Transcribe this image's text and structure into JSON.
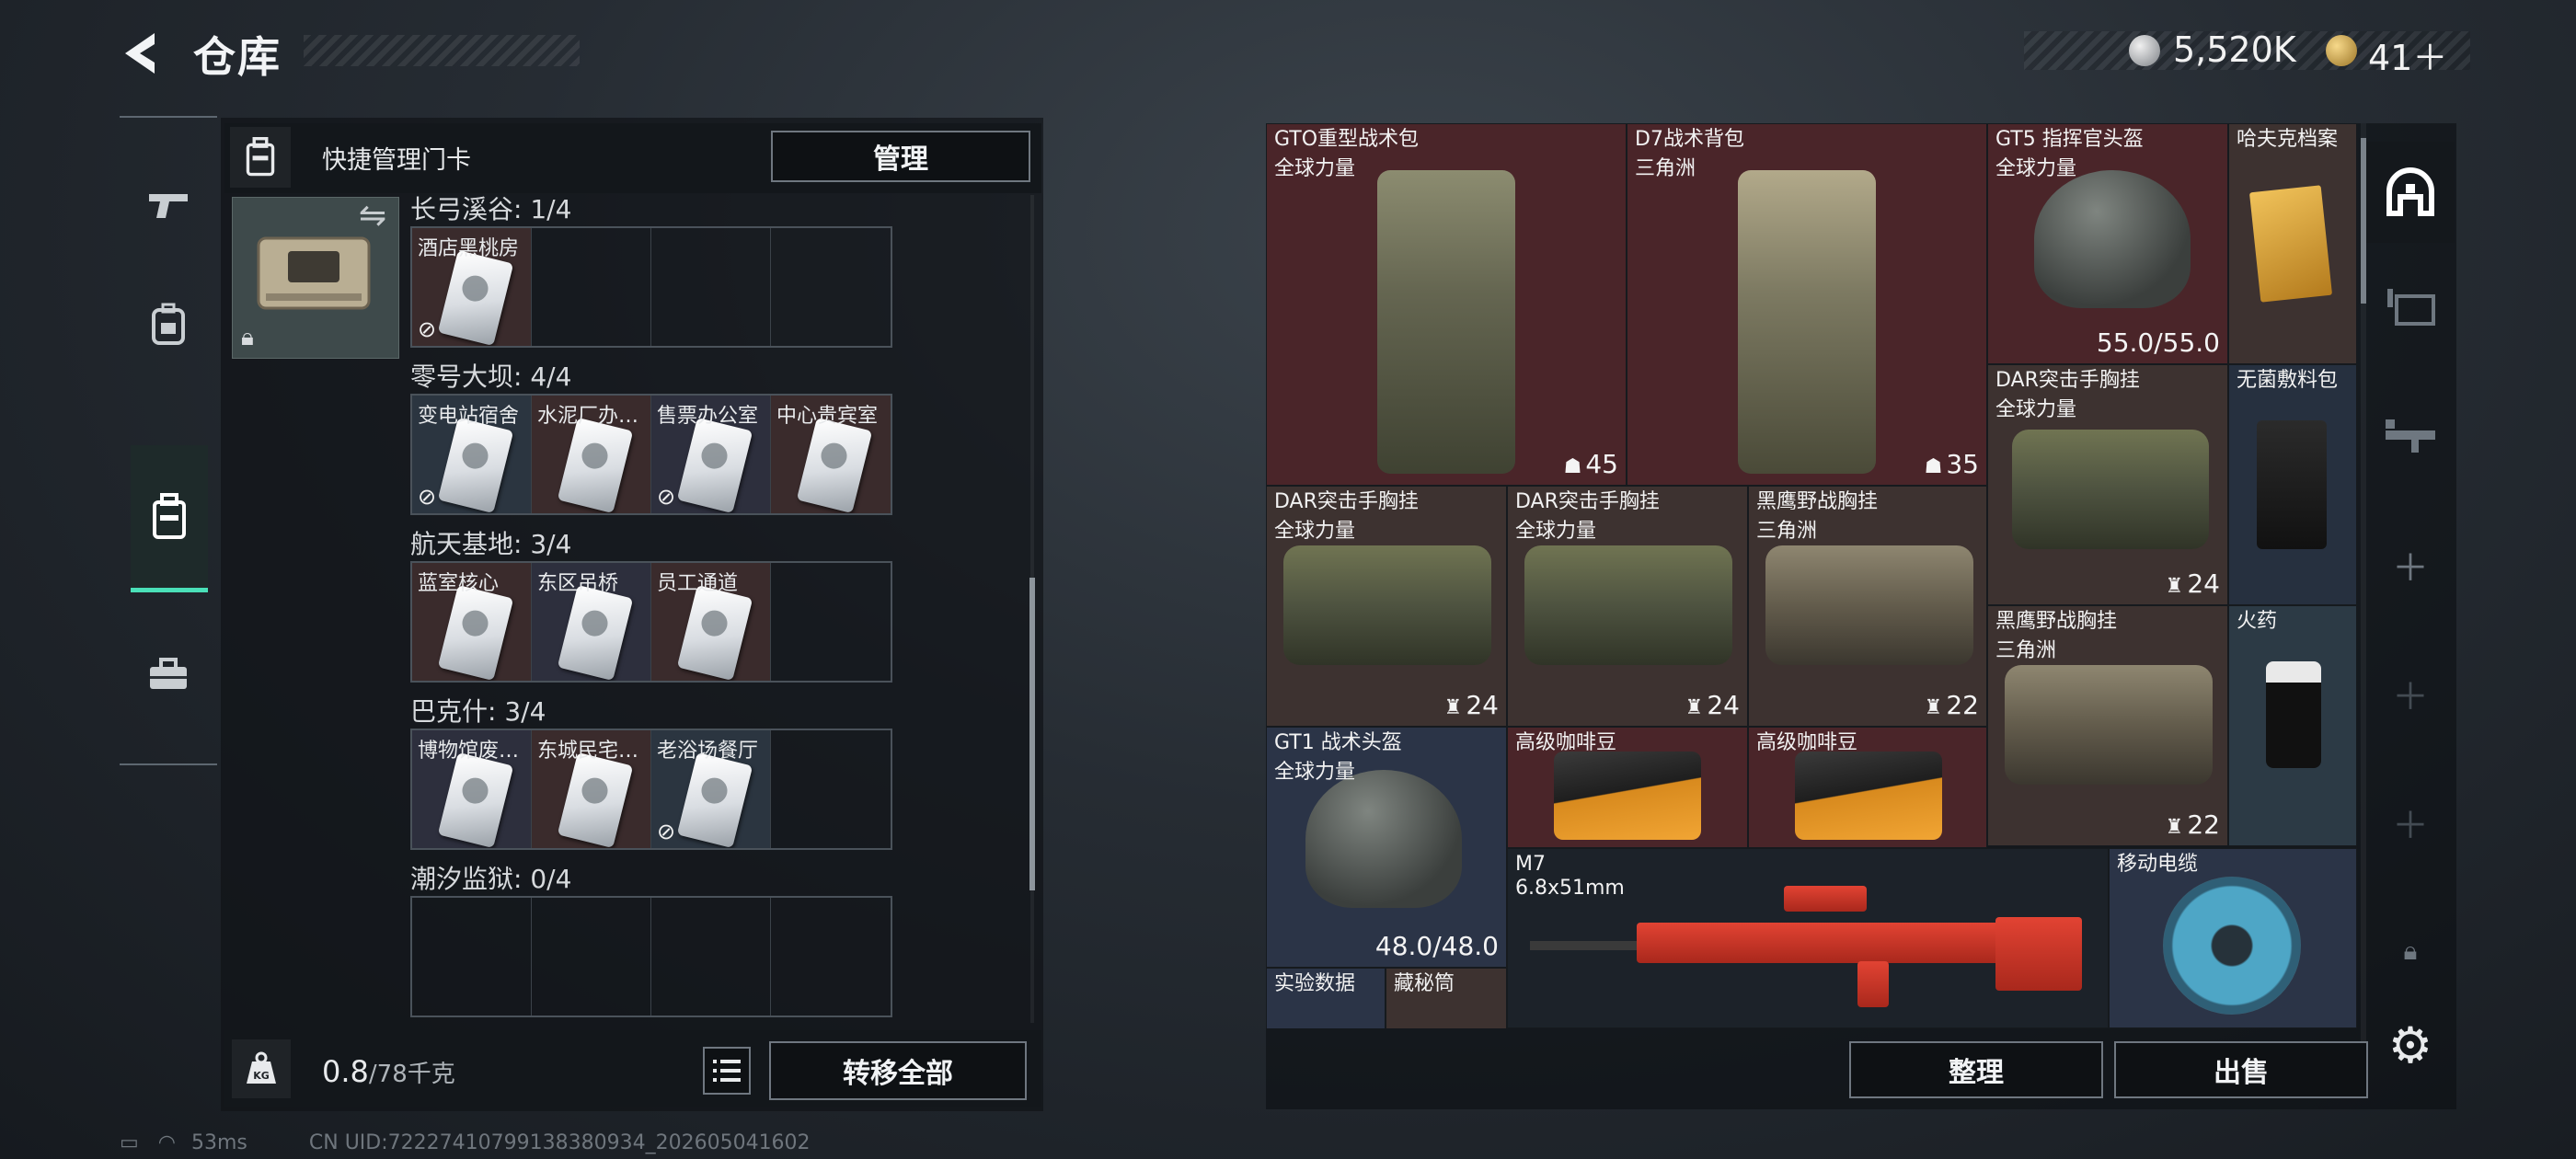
{
  "header": {
    "title": "仓库",
    "currency_silver": "5,520K",
    "currency_gold": "41＋"
  },
  "left_nav": {
    "items": [
      "weapons",
      "equipment",
      "keycards",
      "toolbox"
    ],
    "active": "keycards"
  },
  "keycard_panel": {
    "header_title": "快捷管理门卡",
    "manage_label": "管理",
    "zones": [
      {
        "label": "长弓溪谷: 1/4",
        "cards": [
          {
            "name": "酒店黑桃房",
            "has_card": true,
            "unavailable": true
          }
        ]
      },
      {
        "label": "零号大坝: 4/4",
        "cards": [
          {
            "name": "变电站宿舍",
            "has_card": true,
            "unavailable": true
          },
          {
            "name": "水泥厂办…",
            "has_card": true,
            "unavailable": false
          },
          {
            "name": "售票办公室",
            "has_card": true,
            "unavailable": true
          },
          {
            "name": "中心贵宾室",
            "has_card": true,
            "unavailable": false
          }
        ]
      },
      {
        "label": "航天基地: 3/4",
        "cards": [
          {
            "name": "蓝室核心",
            "has_card": true,
            "unavailable": false
          },
          {
            "name": "东区吊桥",
            "has_card": true,
            "unavailable": false
          },
          {
            "name": "员工通道",
            "has_card": true,
            "unavailable": false
          }
        ]
      },
      {
        "label": "巴克什: 3/4",
        "cards": [
          {
            "name": "博物馆废…",
            "has_card": true,
            "unavailable": false
          },
          {
            "name": "东城民宅…",
            "has_card": true,
            "unavailable": false
          },
          {
            "name": "老浴场餐厅",
            "has_card": true,
            "unavailable": true
          }
        ]
      },
      {
        "label": "潮汐监狱: 0/4",
        "cards": []
      }
    ],
    "weight": "0.8",
    "weight_capacity": "/78千克",
    "transfer_all_label": "转移全部"
  },
  "stash": {
    "items": [
      {
        "name": "GTO重型战术包",
        "sub": "全球力量",
        "stat": "45",
        "stat_icon": "capacity-icon"
      },
      {
        "name": "D7战术背包",
        "sub": "三角洲",
        "stat": "35",
        "stat_icon": "capacity-icon"
      },
      {
        "name": "GT5 指挥官头盔",
        "sub": "全球力量",
        "stat": "55.0/55.0"
      },
      {
        "name": "哈夫克档案",
        "sub": ""
      },
      {
        "name": "DAR突击手胸挂",
        "sub": "全球力量",
        "stat": "24",
        "stat_icon": "slots-icon"
      },
      {
        "name": "无菌敷料包",
        "sub": ""
      },
      {
        "name": "DAR突击手胸挂",
        "sub": "全球力量",
        "stat": "24",
        "stat_icon": "slots-icon"
      },
      {
        "name": "DAR突击手胸挂",
        "sub": "全球力量",
        "stat": "24",
        "stat_icon": "slots-icon"
      },
      {
        "name": "黑鹰野战胸挂",
        "sub": "三角洲",
        "stat": "22",
        "stat_icon": "slots-icon"
      },
      {
        "name": "黑鹰野战胸挂",
        "sub": "三角洲",
        "stat": "22",
        "stat_icon": "slots-icon"
      },
      {
        "name": "火药",
        "sub": ""
      },
      {
        "name": "GT1 战术头盔",
        "sub": "全球力量",
        "stat": "48.0/48.0"
      },
      {
        "name": "高级咖啡豆",
        "sub": ""
      },
      {
        "name": "高级咖啡豆",
        "sub": ""
      },
      {
        "name": "M7",
        "sub": "6.8x51mm"
      },
      {
        "name": "移动电缆",
        "sub": ""
      },
      {
        "name": "实验数据",
        "sub": ""
      },
      {
        "name": "藏秘筒",
        "sub": ""
      }
    ],
    "sort_label": "整理",
    "sell_label": "出售"
  },
  "status_bar": {
    "ping": "53ms",
    "uid": "CN UID:72227410799138380934_202605041602"
  },
  "colors": {
    "accent": "#4ae0b8",
    "rarity_red": "#4a2529",
    "rarity_blue": "#2b3447",
    "rarity_brown": "#3d3230"
  }
}
